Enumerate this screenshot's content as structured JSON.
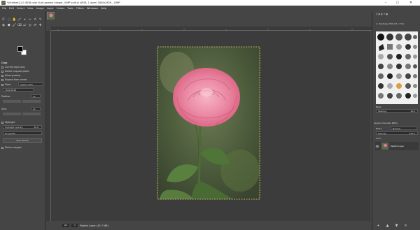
{
  "window": {
    "title": "*[Untitled]-1.0 (RGB color 8-bit gamma integer, GIMP built-in sRGB, 1 layer) 1600x2828 – GIMP",
    "minimize": "–",
    "maximize": "▢",
    "close": "✕"
  },
  "menubar": [
    "File",
    "Edit",
    "Select",
    "View",
    "Image",
    "Layer",
    "Colors",
    "Tools",
    "Filters",
    "Windows",
    "Help"
  ],
  "tool_options": {
    "title": "Crop",
    "opts": [
      "Current layer only",
      "Delete cropped pixels",
      "Allow growing",
      "Expand from center"
    ],
    "fixed_label": "Fixed",
    "fixed_value": "Aspect ratio",
    "size_value": "1600:2828",
    "position_label": "Position:",
    "position_unit": "px",
    "size_label": "Size:",
    "size_unit": "px",
    "highlight_label": "Highlight",
    "highlight_opacity_label": "Highlight opacity",
    "highlight_opacity_value": "50.0",
    "guides_value": "No guides",
    "auto_shrink": "Auto Shrink",
    "shrink_merged": "Shrink merged"
  },
  "tool_icons": [
    "⇱",
    "⬚",
    "✋",
    "⤢",
    "⌖",
    "✂",
    "A",
    "✎",
    "◐",
    "⬣",
    "🖌",
    "⌫",
    "⤾",
    "◎",
    "⟳",
    "✥"
  ],
  "bottom_icons": [
    "⤒",
    "⟲",
    "⊘",
    "⟳"
  ],
  "status": {
    "unit": "px",
    "zoom": "≈",
    "message": "Pasted Layer (45.7 MB)"
  },
  "right_dock": {
    "brushes_title": "2. Hardness 050 (51 × 51)",
    "basic_label": "Basic",
    "spacing_label": "Spacing",
    "spacing_value": "10.0",
    "tabs": "Layers  Channels  Paths",
    "mode_label": "Mode",
    "mode_value": "Normal",
    "opacity_label": "Opacity",
    "opacity_value": "100.0",
    "lock_label": "Lock:",
    "layer_name": "Pasted Layer"
  },
  "colors": {
    "ui_dark": "#454545",
    "canvas_bg": "#3c3c3c",
    "selection": "#d8d36a",
    "rose": "#e67a9a",
    "foreground": "#000000",
    "background": "#ffffff"
  }
}
